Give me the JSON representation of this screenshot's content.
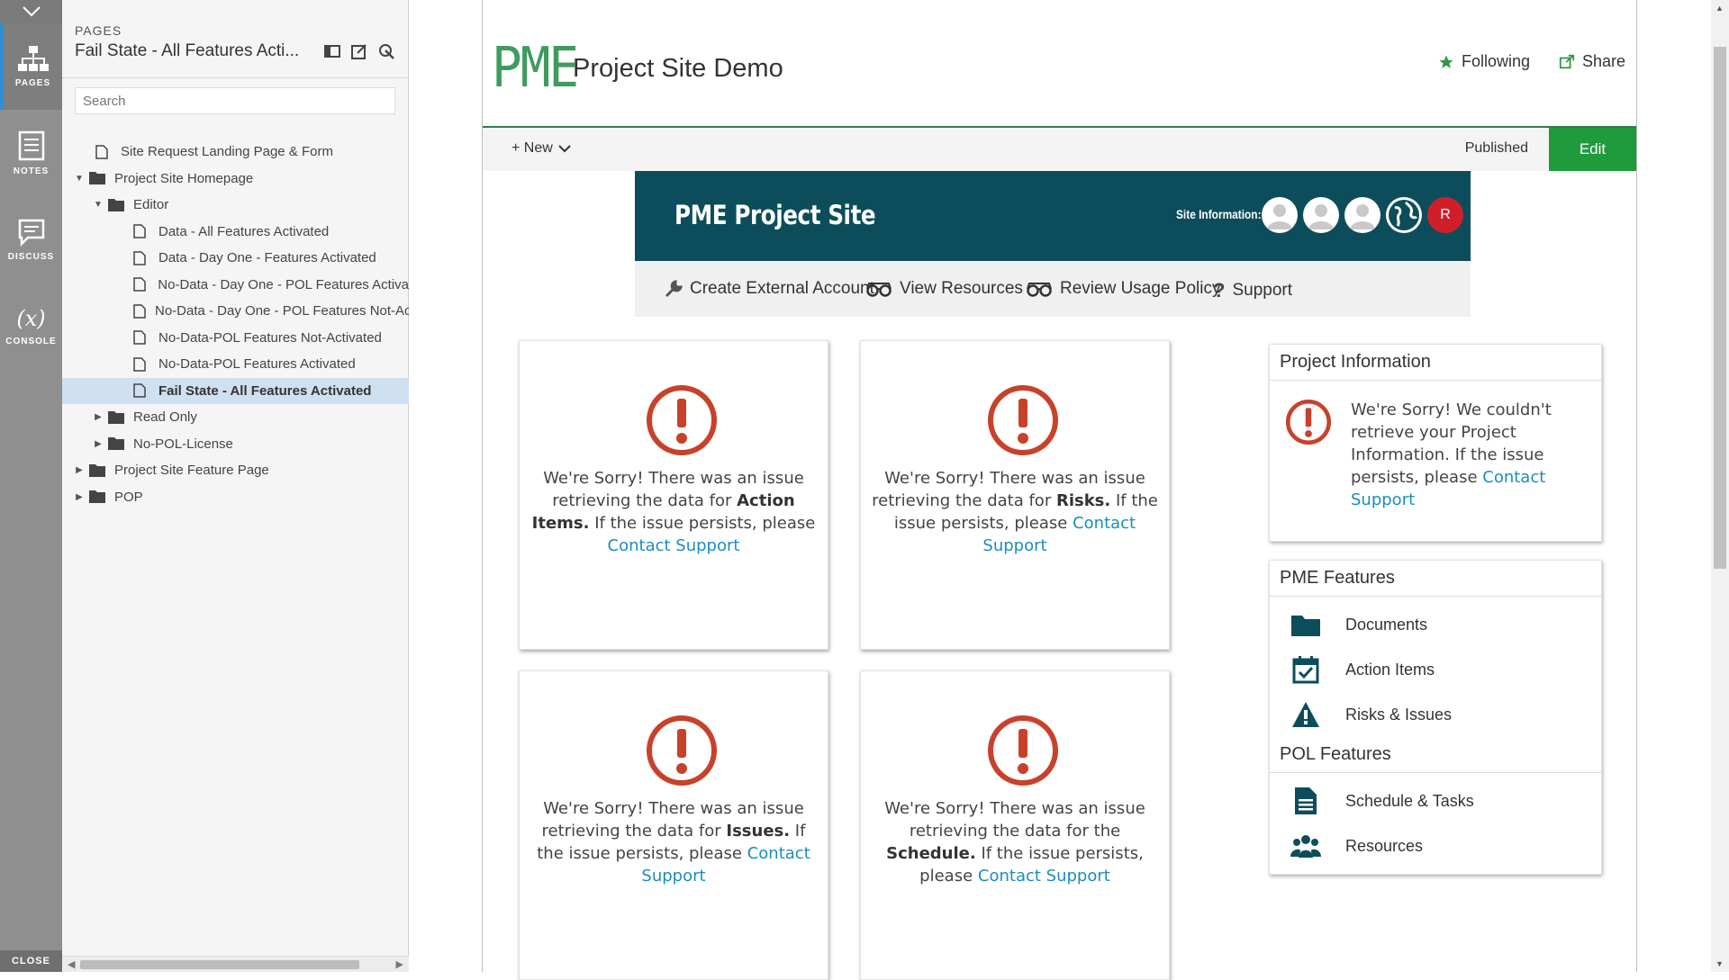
{
  "rail": {
    "items": [
      {
        "label": "PAGES",
        "icon": "sitemap-icon"
      },
      {
        "label": "NOTES",
        "icon": "notes-icon"
      },
      {
        "label": "DISCUSS",
        "icon": "comment-icon"
      },
      {
        "label": "CONSOLE",
        "icon": "console-icon"
      }
    ],
    "close_label": "CLOSE"
  },
  "panel": {
    "kicker": "PAGES",
    "title": "Fail State - All Features Acti...",
    "search_placeholder": "Search",
    "tree": [
      {
        "label": "Site Request Landing Page & Form",
        "type": "page"
      },
      {
        "label": "Project Site Homepage",
        "type": "folder"
      },
      {
        "label": "Editor",
        "type": "folder"
      },
      {
        "label": "Data - All Features Activated",
        "type": "page"
      },
      {
        "label": "Data - Day One - Features Activated",
        "type": "page"
      },
      {
        "label": "No-Data - Day One - POL Features Activa",
        "type": "page"
      },
      {
        "label": "No-Data - Day One - POL Features Not-Ac",
        "type": "page"
      },
      {
        "label": "No-Data-POL Features Not-Activated",
        "type": "page"
      },
      {
        "label": "No-Data-POL Features Activated",
        "type": "page"
      },
      {
        "label": "Fail State - All Features Activated",
        "type": "page",
        "selected": true
      },
      {
        "label": "Read Only",
        "type": "folder"
      },
      {
        "label": "No-POL-License",
        "type": "folder"
      },
      {
        "label": "Project Site Feature Page",
        "type": "folder"
      },
      {
        "label": "POP",
        "type": "folder"
      }
    ]
  },
  "header": {
    "logo": "PME",
    "site_title": "Project Site Demo",
    "following": "Following",
    "share": "Share"
  },
  "cmdbar": {
    "new": "+ New",
    "status": "Published",
    "edit": "Edit"
  },
  "hero": {
    "title": "PME Project Site",
    "info_label": "Site Information:",
    "avatar_initial": "R"
  },
  "quicklinks": [
    {
      "label": "Create External Account",
      "icon": "wrench-icon"
    },
    {
      "label": "View Resources",
      "icon": "glasses-icon"
    },
    {
      "label": "Review Usage Policy",
      "icon": "glasses-icon"
    },
    {
      "label": "Support",
      "icon": "question-icon"
    }
  ],
  "cards": [
    {
      "pre": "We're Sorry! There was an issue retrieving the data for ",
      "bold": "Action Items.",
      "post": " If the issue persists, please ",
      "link": "Contact Support"
    },
    {
      "pre": "We're Sorry! There was an issue retrieving the data for ",
      "bold": "Risks.",
      "post": " If the issue persists, please ",
      "link": "Contact Support"
    },
    {
      "pre": "We're Sorry! There was an issue retrieving the data for ",
      "bold": "Issues.",
      "post": " If the issue persists, please ",
      "link": "Contact Support"
    },
    {
      "pre": "We're Sorry! There was an issue retrieving the data for the ",
      "bold": "Schedule.",
      "post": " If the issue persists, please ",
      "link": "Contact Support"
    }
  ],
  "project_info": {
    "heading": "Project Information",
    "text": "We're Sorry! We couldn't retrieve your Project Information. If the issue persists, please ",
    "link": "Contact Support"
  },
  "pme_features": {
    "heading": "PME Features",
    "items": [
      {
        "label": "Documents",
        "icon": "folder-icon"
      },
      {
        "label": "Action Items",
        "icon": "calendar-check-icon"
      },
      {
        "label": "Risks & Issues",
        "icon": "warning-icon"
      }
    ]
  },
  "pol_features": {
    "heading": "POL Features",
    "items": [
      {
        "label": "Schedule & Tasks",
        "icon": "document-icon"
      },
      {
        "label": "Resources",
        "icon": "users-icon"
      }
    ]
  },
  "colors": {
    "brand_green": "#3f9b5e",
    "hero_teal": "#0d4d5b",
    "edit_green": "#1f9b3b",
    "alert_red": "#c8412a",
    "link_blue": "#1b8dbf"
  }
}
